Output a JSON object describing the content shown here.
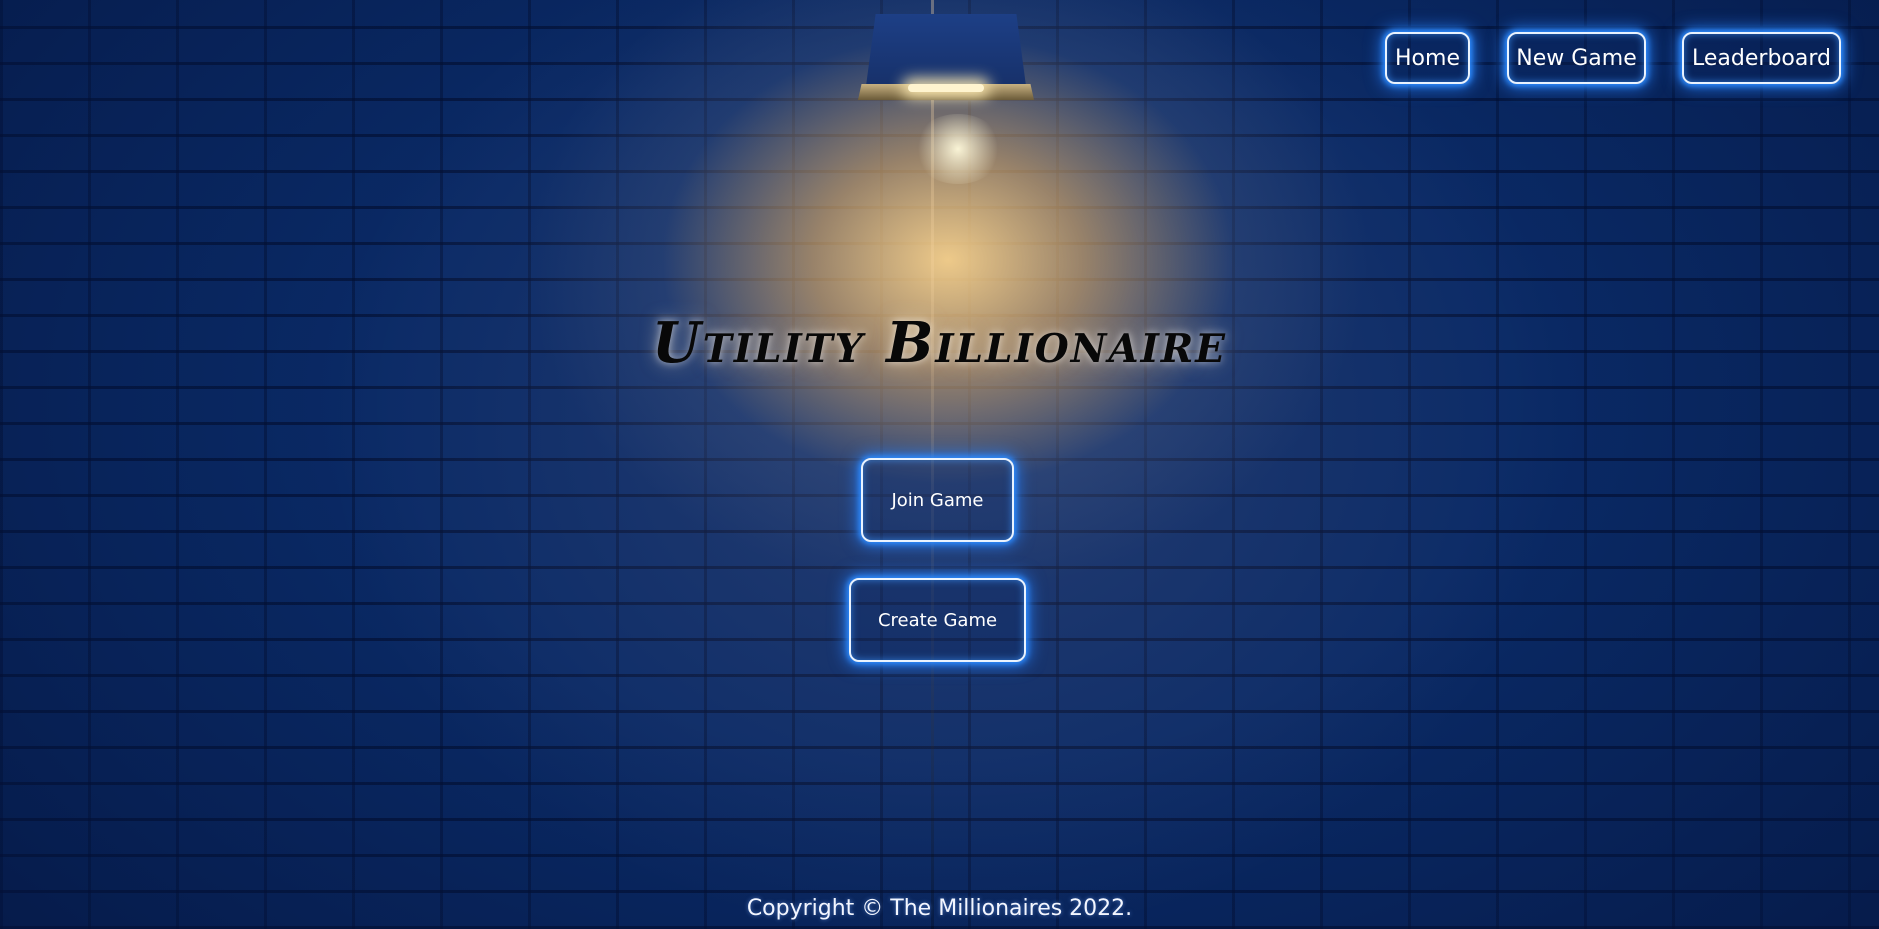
{
  "nav": {
    "items": [
      {
        "label": "Home"
      },
      {
        "label": "New Game"
      },
      {
        "label": "Leaderboard"
      }
    ]
  },
  "hero": {
    "title": "Utility Billionaire",
    "join_label": "Join Game",
    "create_label": "Create Game"
  },
  "footer": {
    "copyright": "Copyright © The Millionaires 2022."
  },
  "theme": {
    "wall_color": "#0a2a66",
    "neon_glow": "#2d8cff",
    "lamp_light": "#ffd68c",
    "title_color": "#080808"
  },
  "icons": {
    "lamp": "wall-lamp-icon"
  }
}
